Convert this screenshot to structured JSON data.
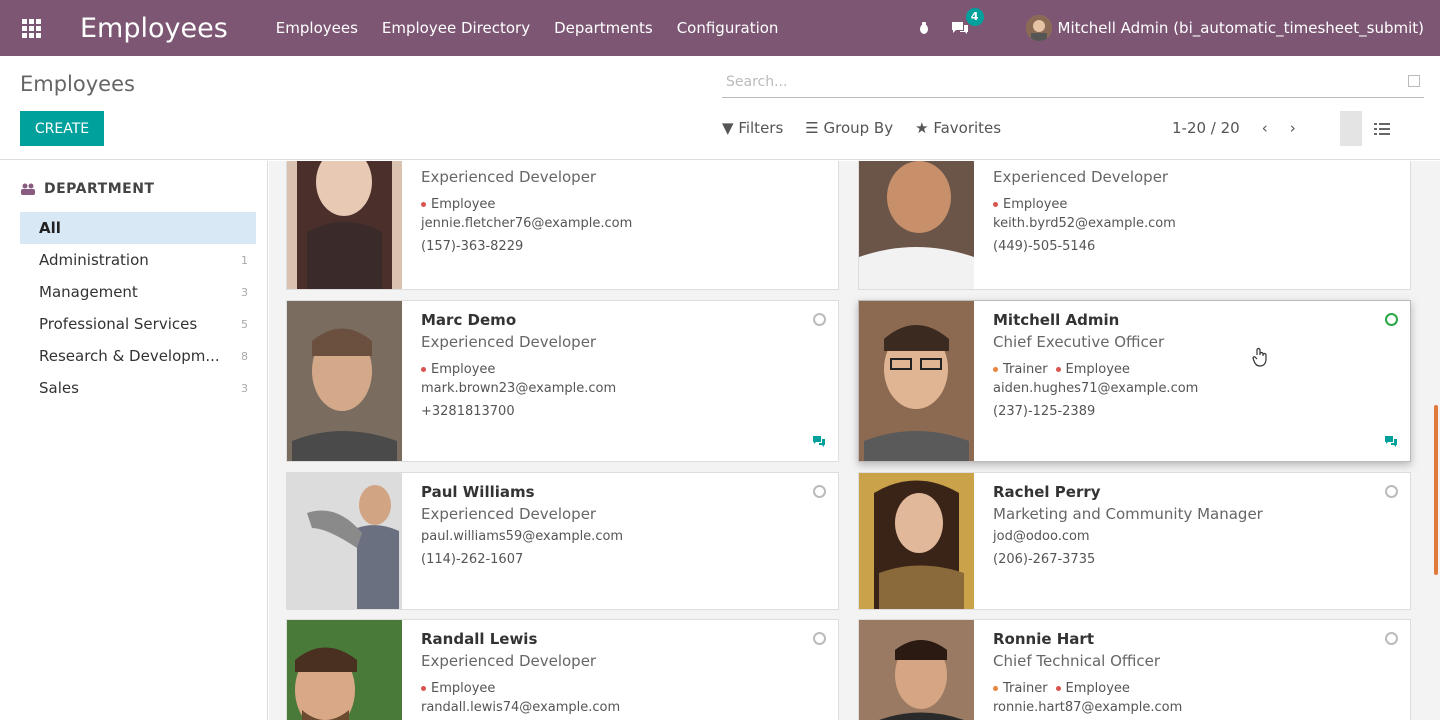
{
  "app": {
    "title": "Employees",
    "menu": [
      "Employees",
      "Employee Directory",
      "Departments",
      "Configuration"
    ],
    "message_count": "4",
    "user": "Mitchell Admin (bi_automatic_timesheet_submit)"
  },
  "control": {
    "breadcrumb": "Employees",
    "create_label": "CREATE",
    "search_placeholder": "Search...",
    "filters_label": "Filters",
    "groupby_label": "Group By",
    "favorites_label": "Favorites",
    "pager": "1-20 / 20"
  },
  "sidebar": {
    "heading": "DEPARTMENT",
    "items": [
      {
        "label": "All",
        "count": ""
      },
      {
        "label": "Administration",
        "count": "1"
      },
      {
        "label": "Management",
        "count": "3"
      },
      {
        "label": "Professional Services",
        "count": "5"
      },
      {
        "label": "Research & Developm...",
        "count": "8"
      },
      {
        "label": "Sales",
        "count": "3"
      }
    ]
  },
  "cards": [
    {
      "name": "",
      "job": "Experienced Developer",
      "tags": [
        "Employee"
      ],
      "email": "jennie.fletcher76@example.com",
      "phone": "(157)-363-8229"
    },
    {
      "name": "",
      "job": "Experienced Developer",
      "tags": [
        "Employee"
      ],
      "email": "keith.byrd52@example.com",
      "phone": "(449)-505-5146"
    },
    {
      "name": "Marc Demo",
      "job": "Experienced Developer",
      "tags": [
        "Employee"
      ],
      "email": "mark.brown23@example.com",
      "phone": "+3281813700"
    },
    {
      "name": "Mitchell Admin",
      "job": "Chief Executive Officer",
      "tags": [
        "Trainer",
        "Employee"
      ],
      "email": "aiden.hughes71@example.com",
      "phone": "(237)-125-2389"
    },
    {
      "name": "Paul Williams",
      "job": "Experienced Developer",
      "tags": [],
      "email": "paul.williams59@example.com",
      "phone": "(114)-262-1607"
    },
    {
      "name": "Rachel Perry",
      "job": "Marketing and Community Manager",
      "tags": [],
      "email": "jod@odoo.com",
      "phone": "(206)-267-3735"
    },
    {
      "name": "Randall Lewis",
      "job": "Experienced Developer",
      "tags": [
        "Employee"
      ],
      "email": "randall.lewis74@example.com",
      "phone": ""
    },
    {
      "name": "Ronnie Hart",
      "job": "Chief Technical Officer",
      "tags": [
        "Trainer",
        "Employee"
      ],
      "email": "ronnie.hart87@example.com",
      "phone": ""
    }
  ],
  "colors": {
    "navbar": "#7c5673",
    "accent": "#00a09d",
    "tag_employee": "#d9534f",
    "tag_trainer": "#e8843c"
  }
}
